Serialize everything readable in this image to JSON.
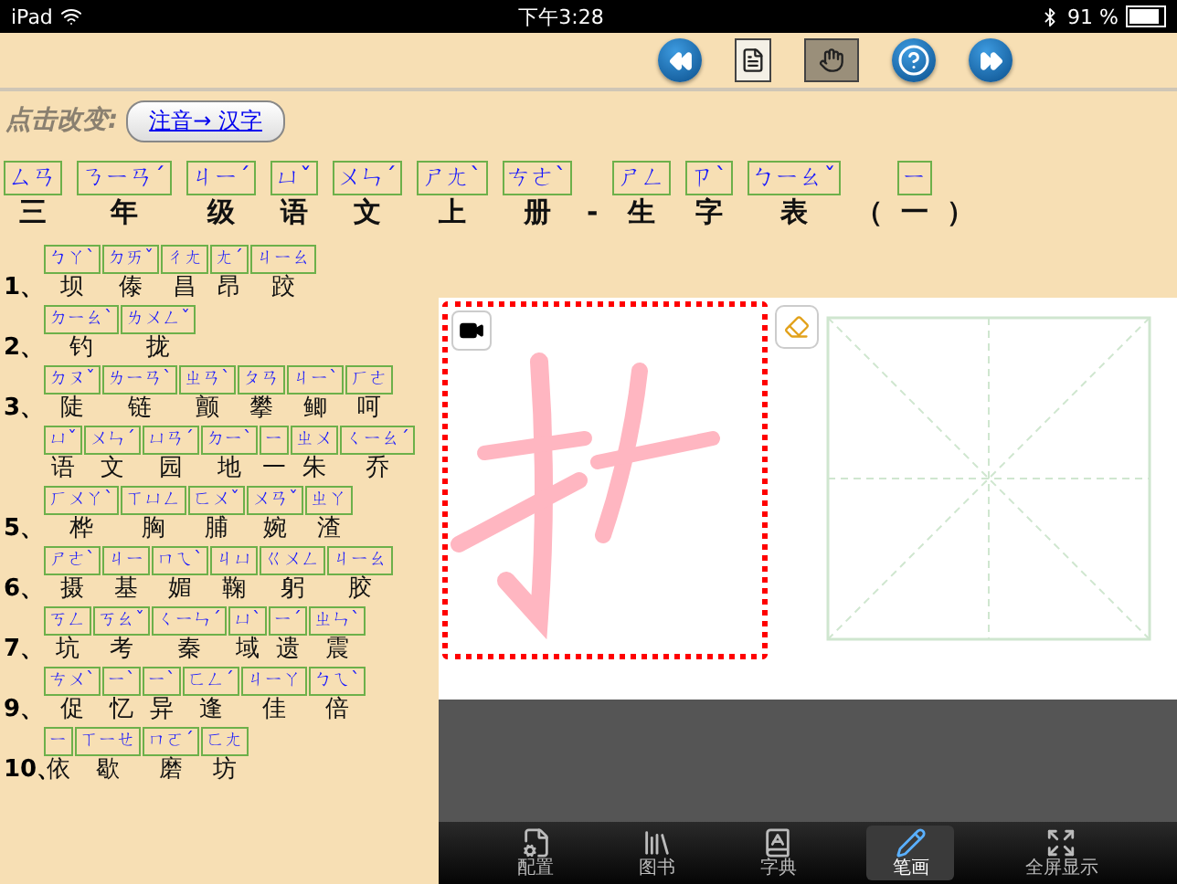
{
  "status_bar": {
    "device": "iPad",
    "time": "下午3:28",
    "battery": "91 %"
  },
  "toolbar": [
    {
      "kind": "rewind"
    },
    {
      "kind": "list"
    },
    {
      "kind": "hand"
    },
    {
      "kind": "help"
    },
    {
      "kind": "forward"
    }
  ],
  "mode": {
    "label": "点击改变:",
    "button": "注音→ 汉字"
  },
  "title": [
    {
      "zhuyin": "ㄙㄢ",
      "hanzi": "三"
    },
    {
      "zhuyin": "ㄋㄧㄢˊ",
      "hanzi": "年"
    },
    {
      "zhuyin": "ㄐㄧˊ",
      "hanzi": "级"
    },
    {
      "zhuyin": "ㄩˇ",
      "hanzi": "语"
    },
    {
      "zhuyin": "ㄨㄣˊ",
      "hanzi": "文"
    },
    {
      "zhuyin": "ㄕㄤˋ",
      "hanzi": "上"
    },
    {
      "zhuyin": "ㄘㄜˋ",
      "hanzi": "册"
    },
    {
      "hanzi": "-"
    },
    {
      "zhuyin": "ㄕㄥ",
      "hanzi": "生"
    },
    {
      "zhuyin": "ㄗˋ",
      "hanzi": "字"
    },
    {
      "zhuyin": "ㄅㄧㄠˇ",
      "hanzi": "表"
    },
    {
      "hanzi": "（"
    },
    {
      "zhuyin": "ㄧ",
      "hanzi": "一"
    },
    {
      "hanzi": "）"
    }
  ],
  "lessons": [
    {
      "number": "1、",
      "items": [
        {
          "zhuyin": "ㄅㄚˋ",
          "hanzi": "坝"
        },
        {
          "zhuyin": "ㄉㄞˇ",
          "hanzi": "傣"
        },
        {
          "zhuyin": "ㄔㄤ",
          "hanzi": "昌"
        },
        {
          "zhuyin": "ㄤˊ",
          "hanzi": "昂"
        },
        {
          "zhuyin": "ㄐㄧㄠ",
          "hanzi": "跤"
        }
      ]
    },
    {
      "number": "2、",
      "items": [
        {
          "zhuyin": "ㄉㄧㄠˋ",
          "hanzi": "钓"
        },
        {
          "zhuyin": "ㄌㄨㄥˇ",
          "hanzi": "拢"
        }
      ]
    },
    {
      "number": "3、",
      "items": [
        {
          "zhuyin": "ㄉㄡˇ",
          "hanzi": "陡"
        },
        {
          "zhuyin": "ㄌㄧㄢˋ",
          "hanzi": "链"
        },
        {
          "zhuyin": "ㄓㄢˋ",
          "hanzi": "颤"
        },
        {
          "zhuyin": "ㄆㄢ",
          "hanzi": "攀"
        },
        {
          "zhuyin": "ㄐㄧˋ",
          "hanzi": "鲫"
        },
        {
          "zhuyin": "ㄏㄜ",
          "hanzi": "呵"
        }
      ]
    },
    {
      "items": [
        {
          "zhuyin": "ㄩˇ",
          "hanzi": "语"
        },
        {
          "zhuyin": "ㄨㄣˊ",
          "hanzi": "文"
        },
        {
          "zhuyin": "ㄩㄢˊ",
          "hanzi": "园"
        },
        {
          "zhuyin": "ㄉㄧˋ",
          "hanzi": "地"
        },
        {
          "zhuyin": "ㄧ",
          "hanzi": "一"
        },
        {
          "zhuyin": "ㄓㄨ",
          "hanzi": "朱"
        },
        {
          "zhuyin": "ㄑㄧㄠˊ",
          "hanzi": "乔"
        }
      ]
    },
    {
      "number": "5、",
      "items": [
        {
          "zhuyin": "ㄏㄨㄚˋ",
          "hanzi": "桦"
        },
        {
          "zhuyin": "ㄒㄩㄥ",
          "hanzi": "胸"
        },
        {
          "zhuyin": "ㄈㄨˇ",
          "hanzi": "脯"
        },
        {
          "zhuyin": "ㄨㄢˇ",
          "hanzi": "婉"
        },
        {
          "zhuyin": "ㄓㄚ",
          "hanzi": "渣"
        }
      ]
    },
    {
      "number": "6、",
      "items": [
        {
          "zhuyin": "ㄕㄜˋ",
          "hanzi": "摄"
        },
        {
          "zhuyin": "ㄐㄧ",
          "hanzi": "基"
        },
        {
          "zhuyin": "ㄇㄟˋ",
          "hanzi": "媚"
        },
        {
          "zhuyin": "ㄐㄩ",
          "hanzi": "鞠"
        },
        {
          "zhuyin": "ㄍㄨㄥ",
          "hanzi": "躬"
        },
        {
          "zhuyin": "ㄐㄧㄠ",
          "hanzi": "胶"
        }
      ]
    },
    {
      "number": "7、",
      "items": [
        {
          "zhuyin": "ㄎㄥ",
          "hanzi": "坑"
        },
        {
          "zhuyin": "ㄎㄠˇ",
          "hanzi": "考"
        },
        {
          "zhuyin": "ㄑㄧㄣˊ",
          "hanzi": "秦"
        },
        {
          "zhuyin": "ㄩˋ",
          "hanzi": "域"
        },
        {
          "zhuyin": "ㄧˊ",
          "hanzi": "遗"
        },
        {
          "zhuyin": "ㄓㄣˋ",
          "hanzi": "震"
        }
      ]
    },
    {
      "number": "9、",
      "items": [
        {
          "zhuyin": "ㄘㄨˋ",
          "hanzi": "促"
        },
        {
          "zhuyin": "ㄧˋ",
          "hanzi": "忆"
        },
        {
          "zhuyin": "ㄧˋ",
          "hanzi": "异"
        },
        {
          "zhuyin": "ㄈㄥˊ",
          "hanzi": "逢"
        },
        {
          "zhuyin": "ㄐㄧㄚ",
          "hanzi": "佳"
        },
        {
          "zhuyin": "ㄅㄟˋ",
          "hanzi": "倍"
        }
      ]
    },
    {
      "number": "10、",
      "items": [
        {
          "zhuyin": "ㄧ",
          "hanzi": "依"
        },
        {
          "zhuyin": "ㄒㄧㄝ",
          "hanzi": "歇"
        },
        {
          "zhuyin": "ㄇㄛˊ",
          "hanzi": "磨"
        },
        {
          "zhuyin": "ㄈㄤ",
          "hanzi": "坊"
        }
      ]
    }
  ],
  "tabs": [
    {
      "kind": "settings",
      "label": "配置",
      "selected": false
    },
    {
      "kind": "books",
      "label": "图书",
      "selected": false
    },
    {
      "kind": "dictionary",
      "label": "字典",
      "selected": false
    },
    {
      "kind": "pen",
      "label": "笔画",
      "selected": true
    },
    {
      "kind": "fullscreen",
      "label": "全屏显示",
      "selected": false
    }
  ]
}
